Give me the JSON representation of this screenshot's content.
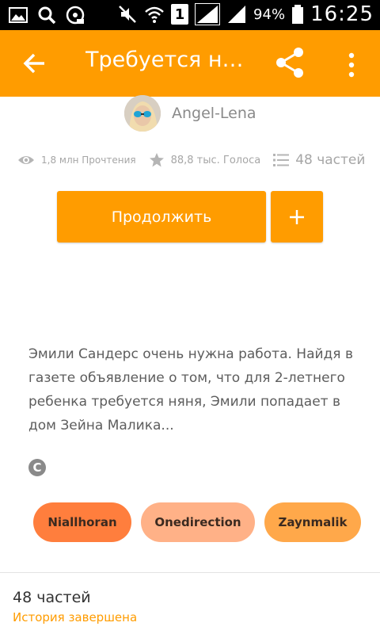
{
  "status_bar": {
    "battery": "94%",
    "time": "16:25",
    "sim_badge": "1"
  },
  "app_bar": {
    "title": "Требуется няня",
    "icons": [
      "back-arrow-icon",
      "share-icon",
      "more-vert-icon"
    ],
    "color": "#FF9C00"
  },
  "author": {
    "name": "Angel-Lena"
  },
  "stats": {
    "reads": "1,8 млн Прочтения",
    "votes": "88,8 тыс. Голоса",
    "parts": "48 частей"
  },
  "actions": {
    "continue_label": "Продолжить",
    "add_label": "+"
  },
  "description": "Эмили Сандерс очень нужна работа. Найдя в газете объявление о том, что для 2-летнего ребенка требуется няня, Эмили попадает в дом Зейна Малика...",
  "copyright_symbol": "C",
  "tags": [
    "Niallhoran",
    "Onedirection",
    "Zaynmalik"
  ],
  "footer": {
    "parts_count": "48 частей",
    "status": "История завершена"
  }
}
